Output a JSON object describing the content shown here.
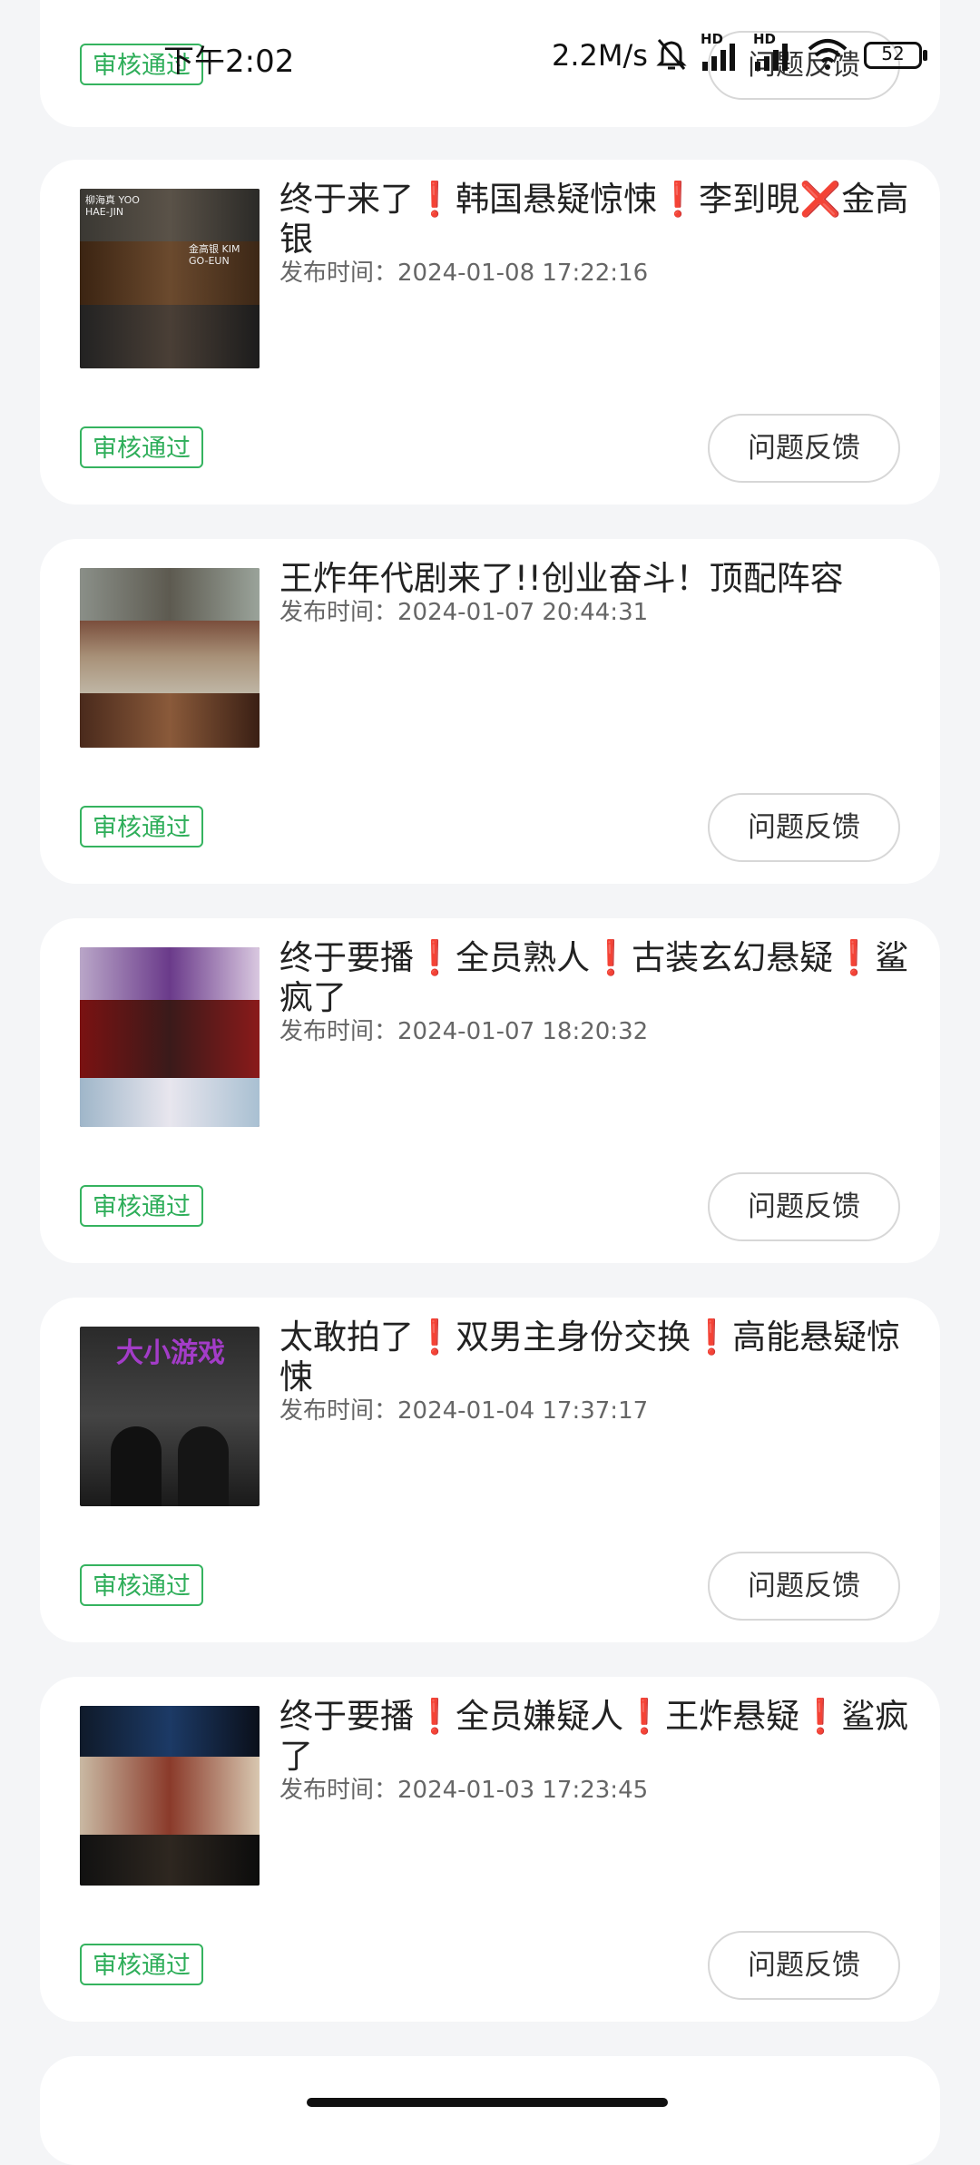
{
  "status_bar": {
    "time": "下午2:02",
    "network_speed": "2.2M/s",
    "hd_label_1": "HD",
    "hd_label_2": "HD",
    "battery": "52"
  },
  "top_card": {
    "status_badge": "审核通过",
    "feedback_button": "问题反馈"
  },
  "cards": [
    {
      "title": "终于来了❗韩国悬疑惊悚❗李到晛❌金高银",
      "time_label": "发布时间：",
      "time": "2024-01-08 17:22:16",
      "status_badge": "审核通过",
      "feedback_button": "问题反馈",
      "thumb_overlay_1": "柳海真 YOO HAE-JIN",
      "thumb_overlay_2": "金高银 KIM GO-EUN"
    },
    {
      "title": "王炸年代剧来了!!创业奋斗！顶配阵容",
      "time_label": "发布时间：",
      "time": "2024-01-07 20:44:31",
      "status_badge": "审核通过",
      "feedback_button": "问题反馈"
    },
    {
      "title": "终于要播❗全员熟人❗古装玄幻悬疑❗鲨疯了",
      "time_label": "发布时间：",
      "time": "2024-01-07 18:20:32",
      "status_badge": "审核通过",
      "feedback_button": "问题反馈"
    },
    {
      "title": "太敢拍了❗双男主身份交换❗高能悬疑惊悚",
      "time_label": "发布时间：",
      "time": "2024-01-04 17:37:17",
      "status_badge": "审核通过",
      "feedback_button": "问题反馈",
      "thumb_overlay_1": "大小游戏"
    },
    {
      "title": "终于要播❗全员嫌疑人❗王炸悬疑❗鲨疯了",
      "time_label": "发布时间：",
      "time": "2024-01-03 17:23:45",
      "status_badge": "审核通过",
      "feedback_button": "问题反馈"
    }
  ],
  "colors": {
    "approved_green": "#2fae5a",
    "page_bg": "#f4f5f7",
    "card_bg": "#ffffff"
  }
}
